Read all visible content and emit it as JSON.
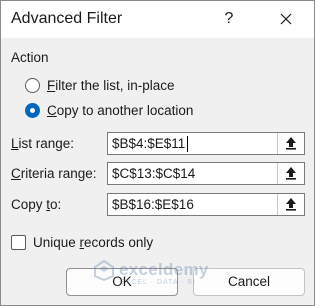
{
  "window": {
    "title": "Advanced Filter",
    "help_label": "?"
  },
  "action": {
    "section_label": "Action",
    "options": [
      {
        "label": "Filter the list, in-place",
        "selected": false
      },
      {
        "label": "Copy to another location",
        "selected": true
      }
    ]
  },
  "fields": {
    "list_range": {
      "label": "List range:",
      "value": "$B$4:$E$11"
    },
    "criteria_range": {
      "label": "Criteria range:",
      "value": "$C$13:$C$14"
    },
    "copy_to": {
      "label": "Copy to:",
      "value": "$B$16:$E$16"
    }
  },
  "unique_records": {
    "label": "Unique records only",
    "checked": false
  },
  "buttons": {
    "ok": "OK",
    "cancel": "Cancel"
  },
  "watermark": {
    "brand": "exceldemy",
    "tagline": "EXCEL · DATA · BI"
  },
  "colors": {
    "accent": "#0067c0",
    "dialog_bg": "#f0f0f0"
  }
}
